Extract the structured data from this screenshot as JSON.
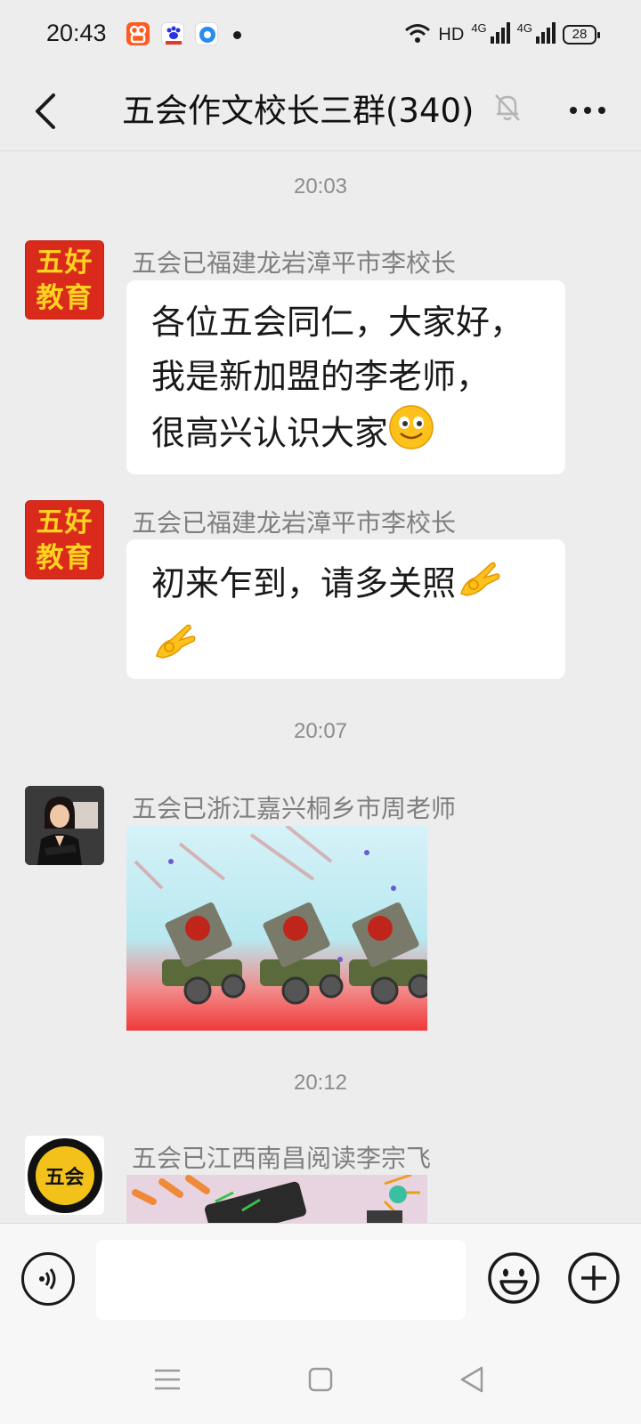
{
  "status_bar": {
    "time": "20:43",
    "hd_label": "HD",
    "net1": "4G",
    "net2": "4G",
    "battery": "28",
    "icons": [
      "kuaishou-app-icon",
      "baidu-app-icon",
      "browser-app-icon",
      "wifi-icon",
      "signal-icon"
    ]
  },
  "header": {
    "title": "五会作文校长三群(340)",
    "icons": [
      "back-arrow-icon",
      "mute-bell-icon",
      "more-icon"
    ]
  },
  "messages": [
    {
      "type": "timestamp",
      "text": "20:03"
    },
    {
      "type": "text",
      "sender": "五会已福建龙岩漳平市李校长",
      "avatar_line1": "五好",
      "avatar_line2": "教育",
      "lines": [
        "各位五会同仁，大家好，",
        "我是新加盟的李老师，",
        "很高兴认识大家"
      ],
      "emoji": "smile-emoji"
    },
    {
      "type": "text",
      "sender": "五会已福建龙岩漳平市李校长",
      "avatar_line1": "五好",
      "avatar_line2": "教育",
      "lines": [
        "初来乍到，请多关照"
      ],
      "emoji": "ok-hand-emoji"
    },
    {
      "type": "timestamp",
      "text": "20:07"
    },
    {
      "type": "image",
      "sender": "五会已浙江嘉兴桐乡市周老师",
      "image_name": "cannon-sticker-image"
    },
    {
      "type": "timestamp",
      "text": "20:12"
    },
    {
      "type": "image",
      "sender": "五会已江西南昌阅读李宗飞",
      "avatar_text": "五会",
      "image_name": "fireworks-sticker-image"
    }
  ],
  "input": {
    "value": "",
    "placeholder": ""
  },
  "colors": {
    "background": "#ededed",
    "bubble": "#ffffff",
    "accent": "#d92a1c",
    "avatar_text": "#ffd21f"
  }
}
